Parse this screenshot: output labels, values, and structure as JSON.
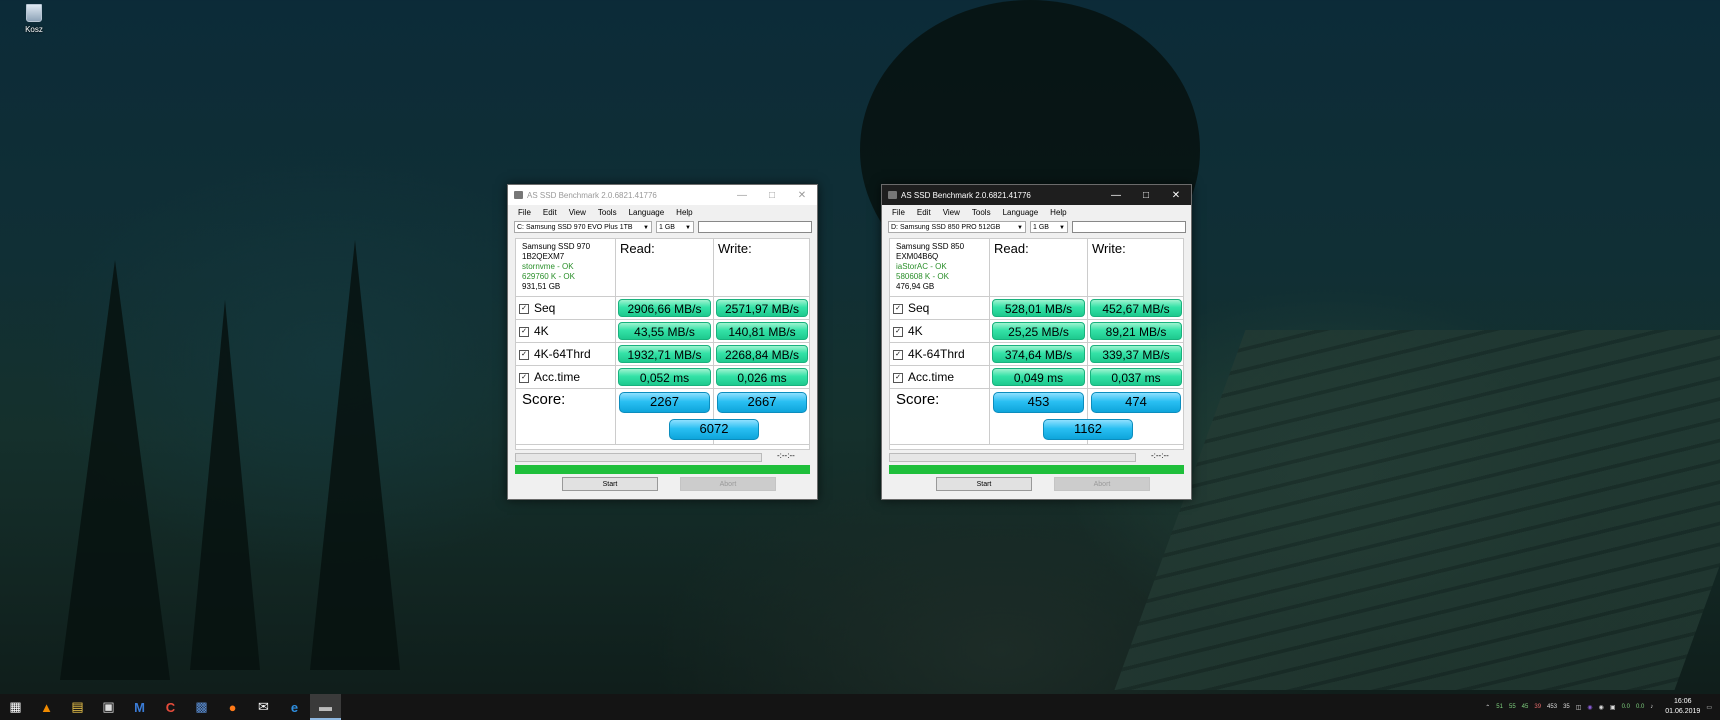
{
  "desktop": {
    "recycle_bin_label": "Kosz"
  },
  "windows": [
    {
      "title": "AS SSD Benchmark 2.0.6821.41776",
      "menu": [
        "File",
        "Edit",
        "View",
        "Tools",
        "Language",
        "Help"
      ],
      "drive": "C: Samsung SSD 970 EVO Plus 1TB",
      "size": "1 GB",
      "info": {
        "model": "Samsung SSD 970",
        "firmware": "1B2QEXM7",
        "driver": "stornvme - OK",
        "align": "629760 K - OK",
        "capacity": "931,51 GB"
      },
      "read_header": "Read:",
      "write_header": "Write:",
      "rows": [
        {
          "label": "Seq",
          "read": "2906,66 MB/s",
          "write": "2571,97 MB/s"
        },
        {
          "label": "4K",
          "read": "43,55 MB/s",
          "write": "140,81 MB/s"
        },
        {
          "label": "4K-64Thrd",
          "read": "1932,71 MB/s",
          "write": "2268,84 MB/s"
        },
        {
          "label": "Acc.time",
          "read": "0,052 ms",
          "write": "0,026 ms"
        }
      ],
      "score_label": "Score:",
      "score_read": "2267",
      "score_write": "2667",
      "score_total": "6072",
      "time": "-:--:--",
      "start": "Start",
      "abort": "Abort"
    },
    {
      "title": "AS SSD Benchmark 2.0.6821.41776",
      "menu": [
        "File",
        "Edit",
        "View",
        "Tools",
        "Language",
        "Help"
      ],
      "drive": "D: Samsung SSD 850 PRO 512GB",
      "size": "1 GB",
      "info": {
        "model": "Samsung SSD 850",
        "firmware": "EXM04B6Q",
        "driver": "iaStorAC - OK",
        "align": "580608 K - OK",
        "capacity": "476,94 GB"
      },
      "read_header": "Read:",
      "write_header": "Write:",
      "rows": [
        {
          "label": "Seq",
          "read": "528,01 MB/s",
          "write": "452,67 MB/s"
        },
        {
          "label": "4K",
          "read": "25,25 MB/s",
          "write": "89,21 MB/s"
        },
        {
          "label": "4K-64Thrd",
          "read": "374,64 MB/s",
          "write": "339,37 MB/s"
        },
        {
          "label": "Acc.time",
          "read": "0,049 ms",
          "write": "0,037 ms"
        }
      ],
      "score_label": "Score:",
      "score_read": "453",
      "score_write": "474",
      "score_total": "1162",
      "time": "-:--:--",
      "start": "Start",
      "abort": "Abort"
    }
  ],
  "taskbar": {
    "icons": [
      "windows-start",
      "vlc",
      "file-explorer",
      "clapper",
      "malwarebytes",
      "ccleaner",
      "save",
      "firefox",
      "mail",
      "edge",
      "as-ssd"
    ],
    "tray_numbers": [
      "51",
      "55",
      "45",
      "39",
      "453",
      "35"
    ],
    "net": [
      "0.0",
      "0.0"
    ],
    "time": "16:06",
    "date": "01.06.2019"
  }
}
